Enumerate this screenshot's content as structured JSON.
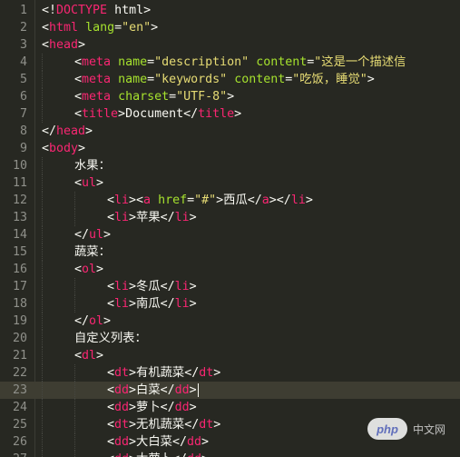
{
  "editor": {
    "current_line": 23,
    "lines": [
      {
        "n": "1",
        "indent": 0,
        "tokens": [
          [
            "t",
            "<!"
          ],
          [
            "tag",
            "DOCTYPE"
          ],
          [
            "t",
            " html>"
          ]
        ]
      },
      {
        "n": "2",
        "indent": 0,
        "tokens": [
          [
            "t",
            "<"
          ],
          [
            "tag",
            "html"
          ],
          [
            "t",
            " "
          ],
          [
            "attr",
            "lang"
          ],
          [
            "t",
            "="
          ],
          [
            "str",
            "\"en\""
          ],
          [
            "t",
            ">"
          ]
        ]
      },
      {
        "n": "3",
        "indent": 0,
        "tokens": [
          [
            "t",
            "<"
          ],
          [
            "tag",
            "head"
          ],
          [
            "t",
            ">"
          ]
        ]
      },
      {
        "n": "4",
        "indent": 1,
        "tokens": [
          [
            "t",
            "<"
          ],
          [
            "tag",
            "meta"
          ],
          [
            "t",
            " "
          ],
          [
            "attr",
            "name"
          ],
          [
            "t",
            "="
          ],
          [
            "str",
            "\"description\""
          ],
          [
            "t",
            " "
          ],
          [
            "attr",
            "content"
          ],
          [
            "t",
            "="
          ],
          [
            "str",
            "\"这是一个描述信"
          ]
        ]
      },
      {
        "n": "5",
        "indent": 1,
        "tokens": [
          [
            "t",
            "<"
          ],
          [
            "tag",
            "meta"
          ],
          [
            "t",
            " "
          ],
          [
            "attr",
            "name"
          ],
          [
            "t",
            "="
          ],
          [
            "str",
            "\"keywords\""
          ],
          [
            "t",
            " "
          ],
          [
            "attr",
            "content"
          ],
          [
            "t",
            "="
          ],
          [
            "str",
            "\"吃饭，睡觉\""
          ],
          [
            "t",
            ">"
          ]
        ]
      },
      {
        "n": "6",
        "indent": 1,
        "tokens": [
          [
            "t",
            "<"
          ],
          [
            "tag",
            "meta"
          ],
          [
            "t",
            " "
          ],
          [
            "attr",
            "charset"
          ],
          [
            "t",
            "="
          ],
          [
            "str",
            "\"UTF-8\""
          ],
          [
            "t",
            ">"
          ]
        ]
      },
      {
        "n": "7",
        "indent": 1,
        "tokens": [
          [
            "t",
            "<"
          ],
          [
            "tag",
            "title"
          ],
          [
            "t",
            ">"
          ],
          [
            "txt",
            "Document"
          ],
          [
            "t",
            "</"
          ],
          [
            "tag",
            "title"
          ],
          [
            "t",
            ">"
          ]
        ]
      },
      {
        "n": "8",
        "indent": 0,
        "tokens": [
          [
            "t",
            "</"
          ],
          [
            "tag",
            "head"
          ],
          [
            "t",
            ">"
          ]
        ]
      },
      {
        "n": "9",
        "indent": 0,
        "tokens": [
          [
            "t",
            "<"
          ],
          [
            "tag",
            "body"
          ],
          [
            "t",
            ">"
          ]
        ]
      },
      {
        "n": "10",
        "indent": 1,
        "tokens": [
          [
            "txt",
            "水果："
          ]
        ]
      },
      {
        "n": "11",
        "indent": 1,
        "tokens": [
          [
            "t",
            "<"
          ],
          [
            "tag",
            "ul"
          ],
          [
            "t",
            ">"
          ]
        ]
      },
      {
        "n": "12",
        "indent": 2,
        "tokens": [
          [
            "t",
            "<"
          ],
          [
            "tag",
            "li"
          ],
          [
            "t",
            "><"
          ],
          [
            "tag",
            "a"
          ],
          [
            "t",
            " "
          ],
          [
            "attr",
            "href"
          ],
          [
            "t",
            "="
          ],
          [
            "str",
            "\"#\""
          ],
          [
            "t",
            ">"
          ],
          [
            "txt",
            "西瓜"
          ],
          [
            "t",
            "</"
          ],
          [
            "tag",
            "a"
          ],
          [
            "t",
            "></"
          ],
          [
            "tag",
            "li"
          ],
          [
            "t",
            ">"
          ]
        ]
      },
      {
        "n": "13",
        "indent": 2,
        "tokens": [
          [
            "t",
            "<"
          ],
          [
            "tag",
            "li"
          ],
          [
            "t",
            ">"
          ],
          [
            "txt",
            "苹果"
          ],
          [
            "t",
            "</"
          ],
          [
            "tag",
            "li"
          ],
          [
            "t",
            ">"
          ]
        ]
      },
      {
        "n": "14",
        "indent": 1,
        "tokens": [
          [
            "t",
            "</"
          ],
          [
            "tag",
            "ul"
          ],
          [
            "t",
            ">"
          ]
        ]
      },
      {
        "n": "15",
        "indent": 1,
        "tokens": [
          [
            "txt",
            "蔬菜："
          ]
        ]
      },
      {
        "n": "16",
        "indent": 1,
        "tokens": [
          [
            "t",
            "<"
          ],
          [
            "tag",
            "ol"
          ],
          [
            "t",
            ">"
          ]
        ]
      },
      {
        "n": "17",
        "indent": 2,
        "tokens": [
          [
            "t",
            "<"
          ],
          [
            "tag",
            "li"
          ],
          [
            "t",
            ">"
          ],
          [
            "txt",
            "冬瓜"
          ],
          [
            "t",
            "</"
          ],
          [
            "tag",
            "li"
          ],
          [
            "t",
            ">"
          ]
        ]
      },
      {
        "n": "18",
        "indent": 2,
        "tokens": [
          [
            "t",
            "<"
          ],
          [
            "tag",
            "li"
          ],
          [
            "t",
            ">"
          ],
          [
            "txt",
            "南瓜"
          ],
          [
            "t",
            "</"
          ],
          [
            "tag",
            "li"
          ],
          [
            "t",
            ">"
          ]
        ]
      },
      {
        "n": "19",
        "indent": 1,
        "tokens": [
          [
            "t",
            "</"
          ],
          [
            "tag",
            "ol"
          ],
          [
            "t",
            ">"
          ]
        ]
      },
      {
        "n": "20",
        "indent": 1,
        "tokens": [
          [
            "txt",
            "自定义列表："
          ]
        ]
      },
      {
        "n": "21",
        "indent": 1,
        "tokens": [
          [
            "t",
            "<"
          ],
          [
            "tag",
            "dl"
          ],
          [
            "t",
            ">"
          ]
        ]
      },
      {
        "n": "22",
        "indent": 2,
        "tokens": [
          [
            "t",
            "<"
          ],
          [
            "tag",
            "dt"
          ],
          [
            "t",
            ">"
          ],
          [
            "txt",
            "有机蔬菜"
          ],
          [
            "t",
            "</"
          ],
          [
            "tag",
            "dt"
          ],
          [
            "t",
            ">"
          ]
        ]
      },
      {
        "n": "23",
        "indent": 2,
        "tokens": [
          [
            "t",
            "<"
          ],
          [
            "tag",
            "dd"
          ],
          [
            "t",
            ">"
          ],
          [
            "txt",
            "白菜"
          ],
          [
            "t",
            "</"
          ],
          [
            "tag",
            "dd"
          ],
          [
            "t",
            ">"
          ]
        ]
      },
      {
        "n": "24",
        "indent": 2,
        "tokens": [
          [
            "t",
            "<"
          ],
          [
            "tag",
            "dd"
          ],
          [
            "t",
            ">"
          ],
          [
            "txt",
            "萝卜"
          ],
          [
            "t",
            "</"
          ],
          [
            "tag",
            "dd"
          ],
          [
            "t",
            ">"
          ]
        ]
      },
      {
        "n": "25",
        "indent": 2,
        "tokens": [
          [
            "t",
            "<"
          ],
          [
            "tag",
            "dt"
          ],
          [
            "t",
            ">"
          ],
          [
            "txt",
            "无机蔬菜"
          ],
          [
            "t",
            "</"
          ],
          [
            "tag",
            "dt"
          ],
          [
            "t",
            ">"
          ]
        ]
      },
      {
        "n": "26",
        "indent": 2,
        "tokens": [
          [
            "t",
            "<"
          ],
          [
            "tag",
            "dd"
          ],
          [
            "t",
            ">"
          ],
          [
            "txt",
            "大白菜"
          ],
          [
            "t",
            "</"
          ],
          [
            "tag",
            "dd"
          ],
          [
            "t",
            ">"
          ]
        ]
      },
      {
        "n": "27",
        "indent": 2,
        "tokens": [
          [
            "t",
            "<"
          ],
          [
            "tag",
            "dd"
          ],
          [
            "t",
            ">"
          ],
          [
            "txt",
            "大萝卜"
          ],
          [
            "t",
            "</"
          ],
          [
            "tag",
            "dd"
          ],
          [
            "t",
            ">"
          ]
        ]
      }
    ]
  },
  "watermark": {
    "logo_text": "php",
    "site_text": "中文网"
  },
  "colors": {
    "background": "#272822",
    "tag": "#f92672",
    "attribute": "#a6e22e",
    "string": "#e6db74",
    "text": "#f8f8f2",
    "line_number": "#8f908a"
  }
}
